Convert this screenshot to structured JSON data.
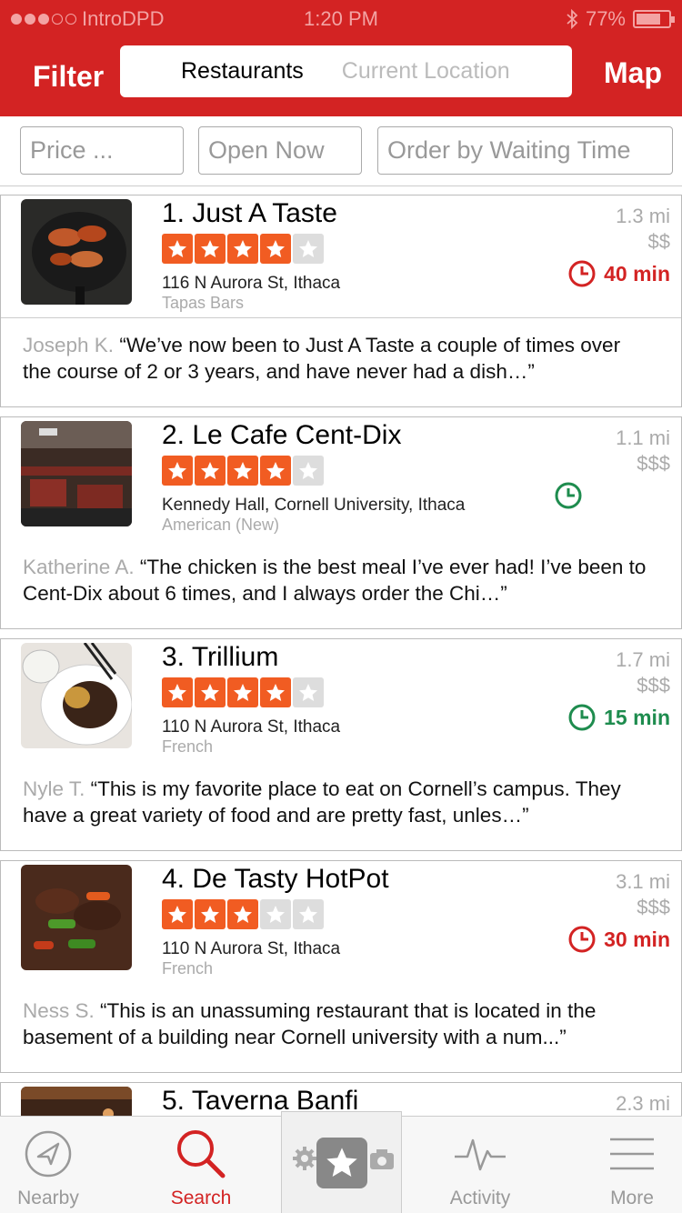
{
  "status_bar": {
    "carrier": "IntroDPD",
    "time": "1:20 PM",
    "battery": "77%",
    "battery_level": 0.77
  },
  "header": {
    "filter_label": "Filter",
    "search_query": "Restaurants",
    "location_placeholder": "Current Location",
    "map_label": "Map",
    "accent": "#d32323"
  },
  "filters": [
    {
      "label": "Price ..."
    },
    {
      "label": "Open Now"
    },
    {
      "label": "Order by Waiting Time"
    }
  ],
  "restaurants": [
    {
      "name": "1. Just A Taste",
      "rating": 4,
      "address": "116 N Aurora St, Ithaca",
      "category": "Tapas Bars",
      "distance": "1.3 mi",
      "price": "$$",
      "wait": "40 min",
      "wait_color": "#d32323",
      "reviewer": "Joseph K.",
      "review": "“We’ve now been to Just A Taste a couple of times over the course of 2 or 3 years, and have never had a dish…”"
    },
    {
      "name": "2. Le Cafe Cent-Dix",
      "rating": 4,
      "address": "Kennedy Hall, Cornell University, Ithaca",
      "category": "American (New)",
      "distance": "1.1 mi",
      "price": "$$$",
      "wait": "",
      "wait_color": "#1e8c4e",
      "reviewer": "Katherine A.",
      "review": "“The chicken is the best meal I’ve ever had! I’ve been to Cent-Dix about 6 times, and I always order the Chi…”"
    },
    {
      "name": "3. Trillium",
      "rating": 4,
      "address": "110 N Aurora St, Ithaca",
      "category": "French",
      "distance": "1.7 mi",
      "price": "$$$",
      "wait": "15 min",
      "wait_color": "#1e8c4e",
      "reviewer": "Nyle T.",
      "review": "“This is my favorite place to eat on Cornell’s campus. They have a great variety of food and are pretty fast, unles…”"
    },
    {
      "name": "4. De Tasty HotPot",
      "rating": 3,
      "address": "110 N Aurora St, Ithaca",
      "category": "French",
      "distance": "3.1 mi",
      "price": "$$$",
      "wait": "30 min",
      "wait_color": "#d32323",
      "reviewer": "Ness S.",
      "review": "“This is an unassuming restaurant that is located in the basement of a building near Cornell university with a num...”"
    },
    {
      "name": "5. Taverna Banfi",
      "rating": 0,
      "address": "",
      "category": "",
      "distance": "2.3 mi",
      "price": "",
      "wait": "",
      "wait_color": "#d32323",
      "reviewer": "",
      "review": ""
    }
  ],
  "tabbar": {
    "nearby": "Nearby",
    "search": "Search",
    "activity": "Activity",
    "more": "More"
  }
}
